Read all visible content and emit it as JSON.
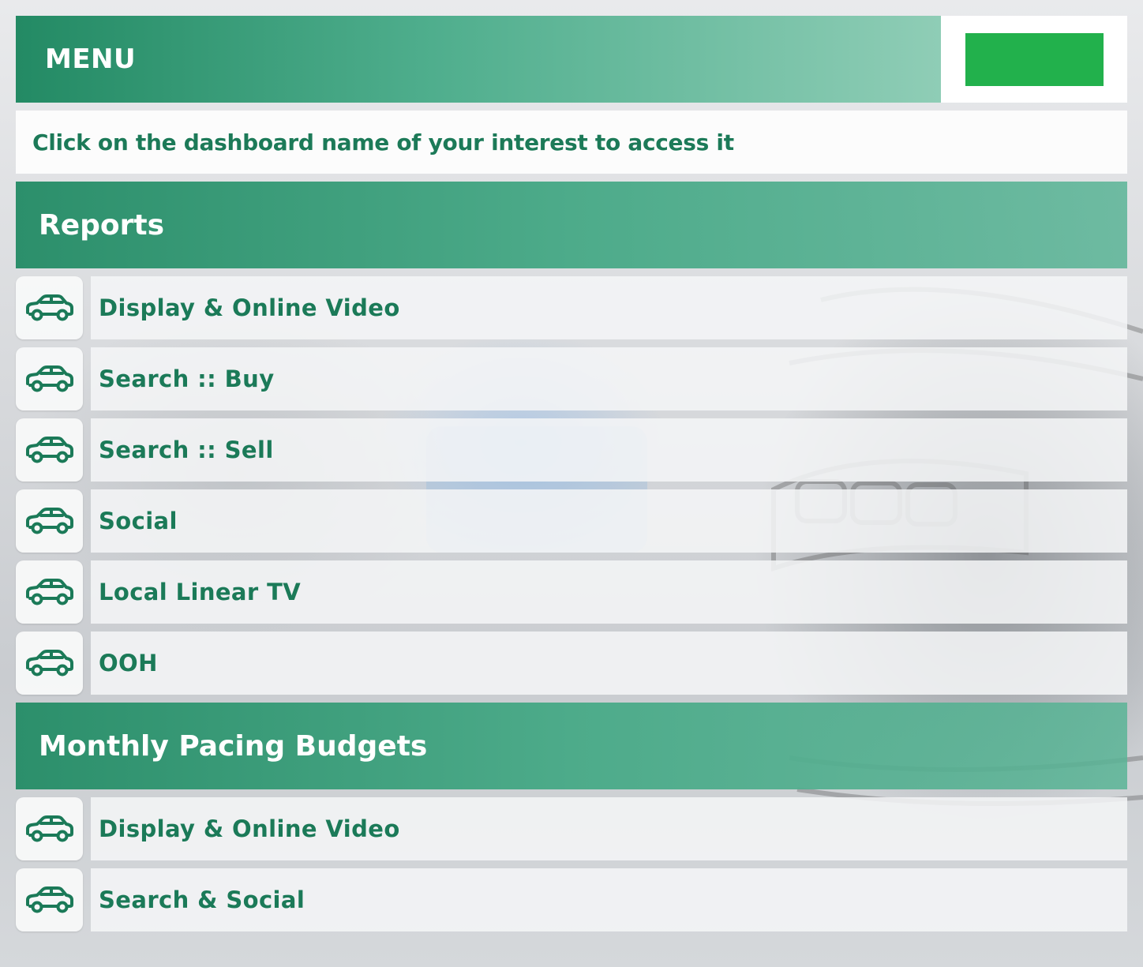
{
  "header": {
    "title": "MENU",
    "logo_color": "#22b14c"
  },
  "instruction": "Click on the dashboard name of your interest to access it",
  "sections": [
    {
      "title": "Reports",
      "items": [
        {
          "label": "Display & Online Video",
          "icon": "car-icon"
        },
        {
          "label": "Search :: Buy",
          "icon": "car-icon"
        },
        {
          "label": "Search :: Sell",
          "icon": "car-icon"
        },
        {
          "label": "Social",
          "icon": "car-icon"
        },
        {
          "label": "Local Linear TV",
          "icon": "car-icon"
        },
        {
          "label": "OOH",
          "icon": "car-icon"
        }
      ]
    },
    {
      "title": "Monthly Pacing Budgets",
      "items": [
        {
          "label": "Display & Online Video",
          "icon": "car-icon"
        },
        {
          "label": "Search & Social",
          "icon": "car-icon"
        }
      ]
    }
  ],
  "colors": {
    "accent_green": "#1b7a58",
    "header_gradient_start": "#238a64",
    "header_gradient_end": "#8fcdb6"
  }
}
